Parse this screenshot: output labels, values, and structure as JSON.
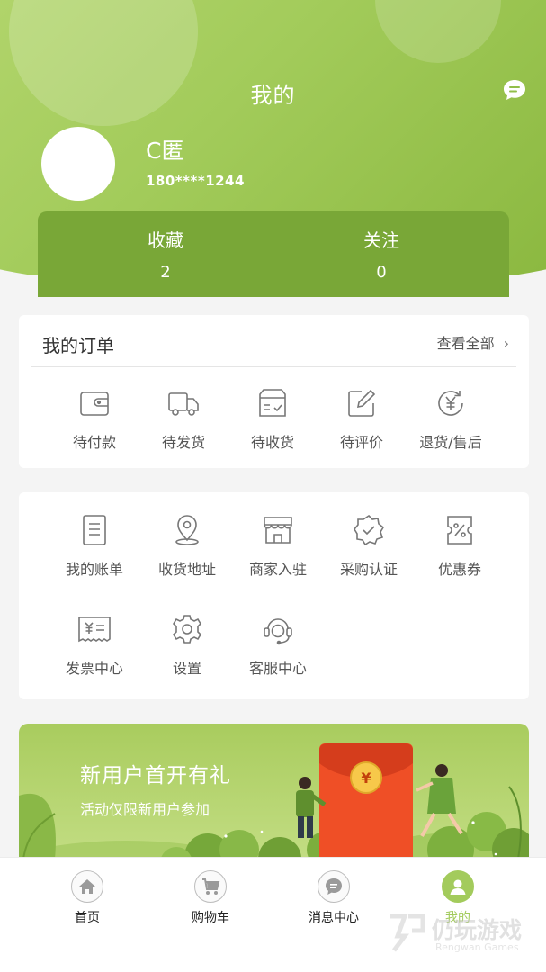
{
  "header": {
    "title": "我的",
    "message_icon": "chat-bubble-icon"
  },
  "user": {
    "name": "C匿",
    "phone": "180****1244"
  },
  "stats": {
    "favorites_label": "收藏",
    "favorites_count": "2",
    "follow_label": "关注",
    "follow_count": "0"
  },
  "orders": {
    "title": "我的订单",
    "view_all": "查看全部",
    "items": [
      {
        "label": "待付款",
        "icon": "wallet-icon"
      },
      {
        "label": "待发货",
        "icon": "truck-icon"
      },
      {
        "label": "待收货",
        "icon": "box-icon"
      },
      {
        "label": "待评价",
        "icon": "edit-icon"
      },
      {
        "label": "退货/售后",
        "icon": "refund-icon"
      }
    ]
  },
  "services": {
    "items": [
      {
        "label": "我的账单",
        "icon": "bill-icon"
      },
      {
        "label": "收货地址",
        "icon": "location-icon"
      },
      {
        "label": "商家入驻",
        "icon": "shop-icon"
      },
      {
        "label": "采购认证",
        "icon": "badge-check-icon"
      },
      {
        "label": "优惠券",
        "icon": "coupon-icon"
      },
      {
        "label": "发票中心",
        "icon": "invoice-icon"
      },
      {
        "label": "设置",
        "icon": "gear-icon"
      },
      {
        "label": "客服中心",
        "icon": "headset-icon"
      }
    ]
  },
  "banner": {
    "title": "新用户首开有礼",
    "subtitle": "活动仅限新用户参加",
    "envelope_symbol": "¥"
  },
  "tabbar": {
    "items": [
      {
        "label": "首页",
        "icon": "home-icon"
      },
      {
        "label": "购物车",
        "icon": "cart-icon"
      },
      {
        "label": "消息中心",
        "icon": "message-icon"
      },
      {
        "label": "我的",
        "icon": "user-icon",
        "active": true
      }
    ]
  },
  "watermark": {
    "main": "仍玩游戏",
    "sub": "Rengwan Games"
  },
  "colors": {
    "brand_green": "#a3cb5c",
    "stats_green": "#79a737",
    "envelope_red": "#f0532a"
  }
}
